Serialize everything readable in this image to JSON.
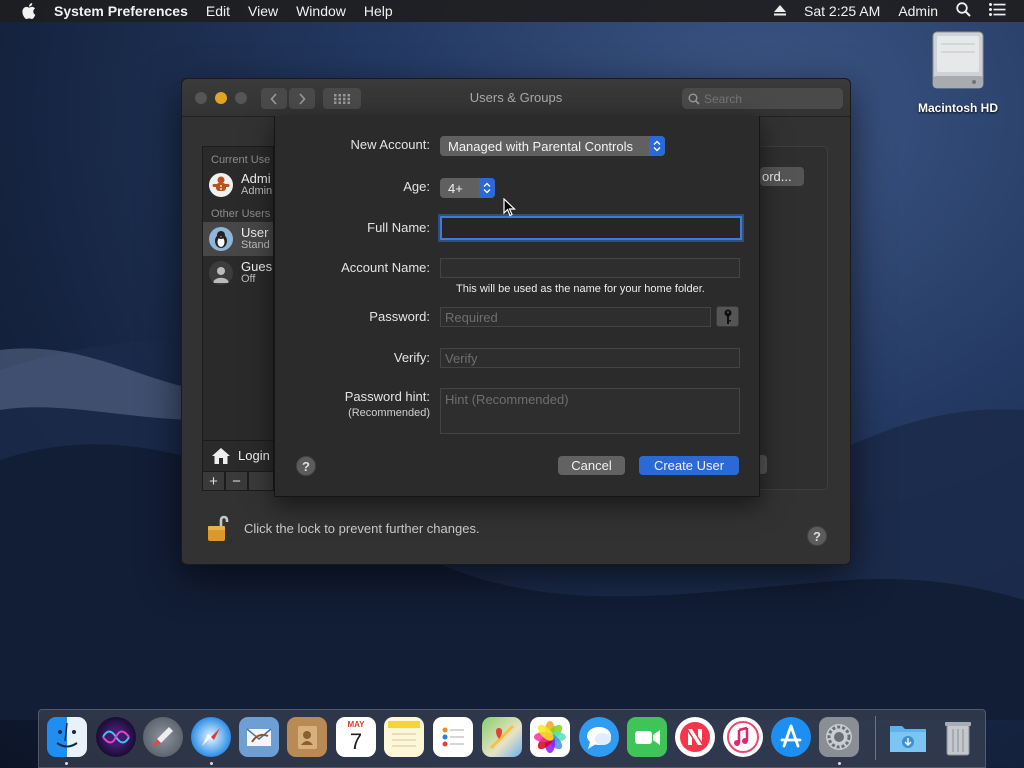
{
  "menubar": {
    "app_name": "System Preferences",
    "menus": [
      "Edit",
      "View",
      "Window",
      "Help"
    ],
    "clock": "Sat 2:25 AM",
    "user": "Admin"
  },
  "desktop": {
    "drive_label": "Macintosh HD"
  },
  "window": {
    "title": "Users & Groups",
    "search_placeholder": "Search",
    "sidebar": {
      "current_users_header": "Current Use",
      "current_user_name": "Admi",
      "current_user_role": "Admin",
      "other_users_header": "Other Users",
      "other_user_name": "User",
      "other_user_role": "Stand",
      "guest_name": "Gues",
      "guest_status": "Off",
      "login_options": "Login"
    },
    "password_button": "ord...",
    "lock_text": "Click the lock to prevent further changes."
  },
  "sheet": {
    "new_account_label": "New Account:",
    "new_account_value": "Managed with Parental Controls",
    "age_label": "Age:",
    "age_value": "4+",
    "full_name_label": "Full Name:",
    "full_name_value": "",
    "account_name_label": "Account Name:",
    "account_name_value": "",
    "account_name_note": "This will be used as the name for your home folder.",
    "password_label": "Password:",
    "password_placeholder": "Required",
    "verify_label": "Verify:",
    "verify_placeholder": "Verify",
    "hint_label": "Password hint:",
    "hint_sub_label": "(Recommended)",
    "hint_placeholder": "Hint (Recommended)",
    "cancel_label": "Cancel",
    "create_label": "Create User",
    "help_label": "?"
  },
  "dock": {
    "calendar_month": "MAY",
    "calendar_day": "7",
    "apps": [
      "finder-icon",
      "siri-icon",
      "launchpad-icon",
      "safari-icon",
      "mail-icon",
      "contacts-icon",
      "calendar-icon",
      "notes-icon",
      "reminders-icon",
      "maps-icon",
      "photos-icon",
      "messages-icon",
      "facetime-icon",
      "news-icon",
      "itunes-icon",
      "app-store-icon",
      "system-preferences-icon",
      "downloads-icon",
      "trash-icon"
    ]
  }
}
